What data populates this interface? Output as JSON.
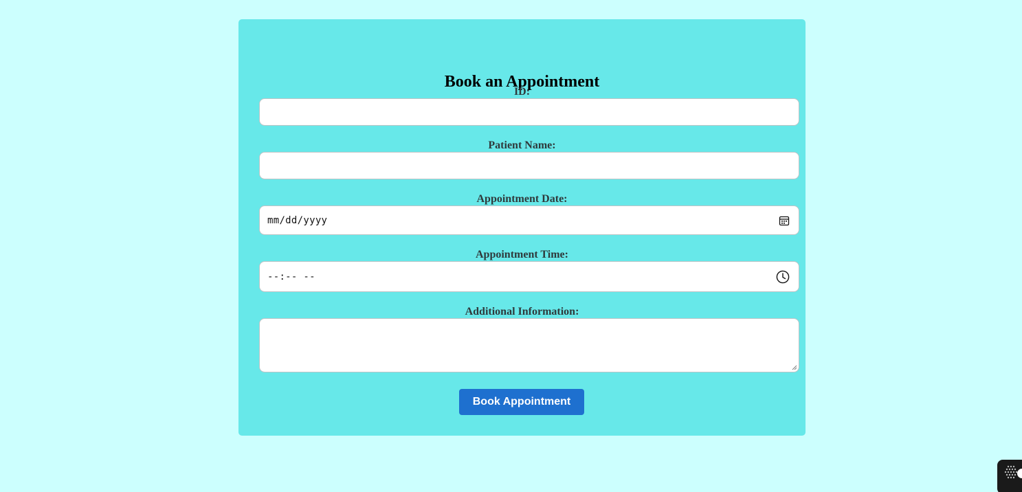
{
  "form": {
    "title": "Book an Appointment",
    "id_label": "ID:",
    "id_value": "",
    "patient_name_label": "Patient Name:",
    "patient_name_value": "",
    "date_label": "Appointment Date:",
    "date_placeholder": "mm/dd/yyyy",
    "date_icon": "calendar-icon",
    "time_label": "Appointment Time:",
    "time_placeholder": "--:-- --",
    "time_icon": "clock-icon",
    "additional_info_label": "Additional Information:",
    "additional_info_value": "",
    "submit_label": "Book Appointment"
  },
  "colors": {
    "page_background": "#ccfffe",
    "card_background": "#67e8e9",
    "button_background": "#1e70cf",
    "button_text": "#ffffff"
  },
  "corner_badge": {
    "icon": "blackbox-logo-icon"
  }
}
